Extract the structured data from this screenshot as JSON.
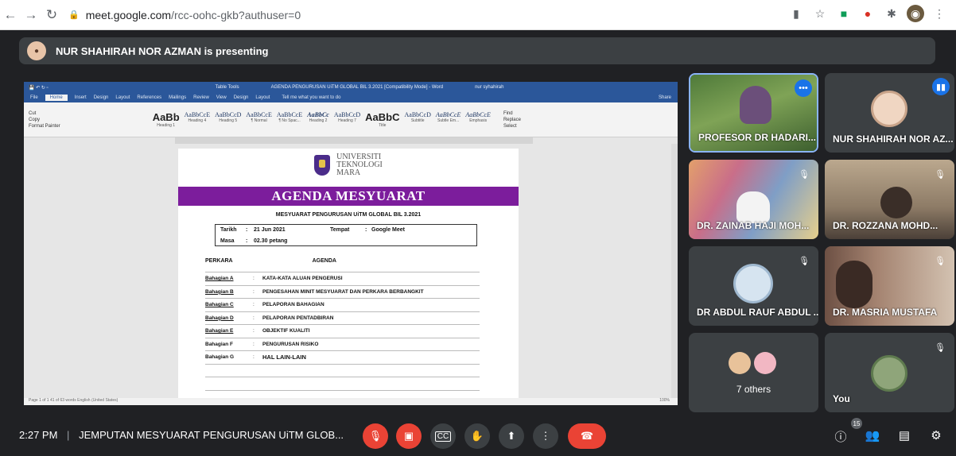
{
  "browser": {
    "url_host": "meet.google.com",
    "url_path": "/rcc-oohc-gkb?authuser=0"
  },
  "banner": {
    "presenting_text": "NUR SHAHIRAH NOR AZMAN is presenting"
  },
  "word": {
    "title": "AGENDA PENGURUSAN UiTM GLOBAL BIL 3.2021 [Compatibility Mode] - Word",
    "tool_tab": "Table Tools",
    "user": "nur syhahirah",
    "tabs": [
      "File",
      "Home",
      "Insert",
      "Design",
      "Layout",
      "References",
      "Mailings",
      "Review",
      "View",
      "Design",
      "Layout"
    ],
    "tell_me": "Tell me what you want to do",
    "share": "Share",
    "clipboard": [
      "Cut",
      "Copy",
      "Format Painter"
    ],
    "styles": [
      "AaBb",
      "AaBbCcE",
      "AaBbCcD",
      "AaBbCcE",
      "AaBbCcE",
      "AaBbCc",
      "AaBbCcD",
      "AaBbC",
      "AaBbCcD",
      "AaBbCcE",
      "AaBbCcE"
    ],
    "style_names": [
      "Heading 1",
      "Heading 4",
      "Heading 5",
      "¶ Normal",
      "¶ No Spac...",
      "Heading 2",
      "Heading 7",
      "Title",
      "Subtitle",
      "Subtle Em...",
      "Emphasis"
    ],
    "editing": [
      "Find",
      "Replace",
      "Select"
    ],
    "status": "Page 1 of 1   41 of 63 words   English (United States)",
    "zoom": "100%"
  },
  "doc": {
    "uni_line1": "UNIVERSITI",
    "uni_line2": "TEKNOLOGI",
    "uni_line3": "MARA",
    "banner": "AGENDA MESYUARAT",
    "meeting_title": "MESYUARAT PENGURUSAN UiTM GLOBAL BIL 3.2021",
    "tarikh_label": "Tarikh",
    "tarikh_value": "21 Jun 2021",
    "tempat_label": "Tempat",
    "tempat_value": "Google Meet",
    "masa_label": "Masa",
    "masa_value": "02.30 petang",
    "perkara": "PERKARA",
    "agenda_head": "AGENDA",
    "items": [
      {
        "code": "Bahagian A",
        "desc": "KATA-KATA ALUAN PENGERUSI"
      },
      {
        "code": "Bahagian B",
        "desc": "PENGESAHAN MINIT MESYUARAT DAN PERKARA BERBANGKIT"
      },
      {
        "code": "Bahagian C",
        "desc": "PELAPORAN BAHAGIAN"
      },
      {
        "code": "Bahagian D",
        "desc": "PELAPORAN PENTADBIRAN"
      },
      {
        "code": "Bahagian E",
        "desc": "OBJEKTIF KUALITI"
      },
      {
        "code": "Bahagian F",
        "desc": "PENGURUSAN RISIKO"
      },
      {
        "code": "Bahagian G",
        "desc": "HAL LAIN-LAIN"
      }
    ]
  },
  "tiles": {
    "t1": "PROFESOR DR HADARI...",
    "t2": "NUR SHAHIRAH NOR AZ...",
    "t3": "DR. ZAINAB HAJI MOH...",
    "t4": "DR. ROZZANA MOHD...",
    "t5": "DR ABDUL RAUF ABDUL ...",
    "t6": "DR. MASRIA MUSTAFA",
    "t7": "7 others",
    "t8": "You"
  },
  "bottom": {
    "time": "2:27 PM",
    "meeting_name": "JEMPUTAN MESYUARAT PENGURUSAN UiTM GLOB...",
    "participant_count": "15"
  },
  "colors": {
    "accent_blue": "#1a73e8",
    "end_call_red": "#ea4335",
    "agenda_purple": "#7c1d9c",
    "word_blue": "#2b579a"
  }
}
